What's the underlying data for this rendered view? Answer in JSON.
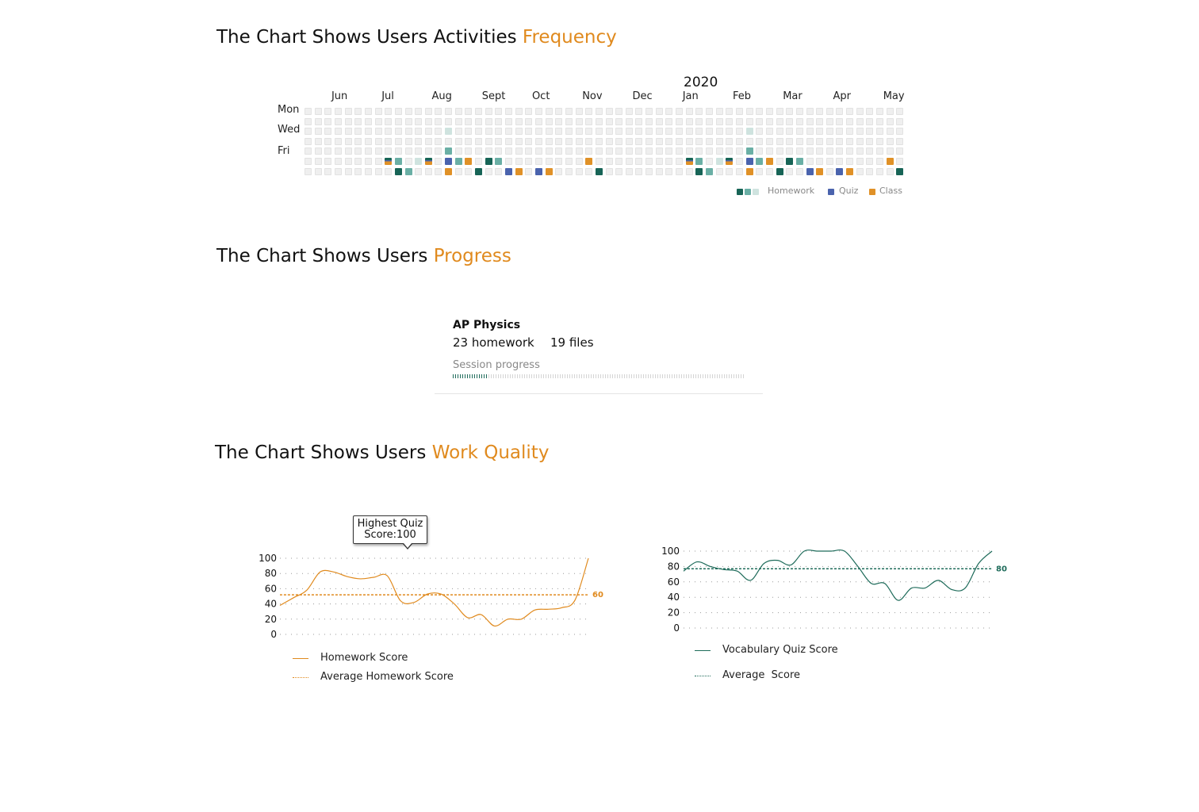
{
  "sections": {
    "frequency": {
      "title_prefix": "The Chart Shows Users Activities ",
      "title_accent": "Frequency"
    },
    "progress": {
      "title_prefix": "The Chart Shows Users ",
      "title_accent": "Progress"
    },
    "quality": {
      "title_prefix": "The Chart Shows Users ",
      "title_accent": "Work Quality"
    }
  },
  "heatmap": {
    "year": "2020",
    "months": [
      "Jun",
      "Jul",
      "Aug",
      "Sept",
      "Oct",
      "Nov",
      "Dec",
      "Jan",
      "Feb",
      "Mar",
      "Apr",
      "May"
    ],
    "month_start_weeks": [
      3,
      8,
      13,
      18,
      23,
      28,
      33,
      38,
      43,
      48,
      53,
      58
    ],
    "days": [
      "Mon",
      "Wed",
      "Fri"
    ],
    "weeks": 60,
    "colors": {
      "empty": "#efefef",
      "homework_dark": "#176456",
      "homework_mid": "#6aafa5",
      "homework_light": "#cfe3df",
      "quiz": "#4a63ad",
      "class": "#e09127"
    },
    "legend": {
      "homework": "Homework",
      "quiz": "Quiz",
      "class": "Class"
    },
    "activities": [
      {
        "w": 8,
        "d": 5,
        "t": "split"
      },
      {
        "w": 9,
        "d": 5,
        "t": "homework_mid"
      },
      {
        "w": 9,
        "d": 6,
        "t": "homework_dark"
      },
      {
        "w": 10,
        "d": 6,
        "t": "homework_mid"
      },
      {
        "w": 11,
        "d": 5,
        "t": "homework_light"
      },
      {
        "w": 12,
        "d": 5,
        "t": "split"
      },
      {
        "w": 14,
        "d": 2,
        "t": "homework_light"
      },
      {
        "w": 14,
        "d": 4,
        "t": "homework_mid"
      },
      {
        "w": 14,
        "d": 5,
        "t": "quiz"
      },
      {
        "w": 14,
        "d": 6,
        "t": "class"
      },
      {
        "w": 15,
        "d": 5,
        "t": "homework_mid"
      },
      {
        "w": 16,
        "d": 5,
        "t": "class"
      },
      {
        "w": 17,
        "d": 6,
        "t": "homework_dark"
      },
      {
        "w": 18,
        "d": 5,
        "t": "homework_dark"
      },
      {
        "w": 19,
        "d": 5,
        "t": "homework_mid"
      },
      {
        "w": 20,
        "d": 6,
        "t": "quiz"
      },
      {
        "w": 21,
        "d": 6,
        "t": "class"
      },
      {
        "w": 23,
        "d": 6,
        "t": "quiz"
      },
      {
        "w": 24,
        "d": 6,
        "t": "class"
      },
      {
        "w": 28,
        "d": 5,
        "t": "class"
      },
      {
        "w": 29,
        "d": 6,
        "t": "homework_dark"
      },
      {
        "w": 38,
        "d": 5,
        "t": "split"
      },
      {
        "w": 39,
        "d": 5,
        "t": "homework_mid"
      },
      {
        "w": 39,
        "d": 6,
        "t": "homework_dark"
      },
      {
        "w": 40,
        "d": 6,
        "t": "homework_mid"
      },
      {
        "w": 41,
        "d": 5,
        "t": "homework_light"
      },
      {
        "w": 42,
        "d": 5,
        "t": "split"
      },
      {
        "w": 44,
        "d": 2,
        "t": "homework_light"
      },
      {
        "w": 44,
        "d": 4,
        "t": "homework_mid"
      },
      {
        "w": 44,
        "d": 5,
        "t": "quiz"
      },
      {
        "w": 44,
        "d": 6,
        "t": "class"
      },
      {
        "w": 45,
        "d": 5,
        "t": "homework_mid"
      },
      {
        "w": 46,
        "d": 5,
        "t": "class"
      },
      {
        "w": 47,
        "d": 6,
        "t": "homework_dark"
      },
      {
        "w": 48,
        "d": 5,
        "t": "homework_dark"
      },
      {
        "w": 49,
        "d": 5,
        "t": "homework_mid"
      },
      {
        "w": 50,
        "d": 6,
        "t": "quiz"
      },
      {
        "w": 51,
        "d": 6,
        "t": "class"
      },
      {
        "w": 53,
        "d": 6,
        "t": "quiz"
      },
      {
        "w": 54,
        "d": 6,
        "t": "class"
      },
      {
        "w": 58,
        "d": 5,
        "t": "class"
      },
      {
        "w": 59,
        "d": 6,
        "t": "homework_dark"
      }
    ]
  },
  "progress_card": {
    "course": "AP Physics",
    "homework": "23 homework",
    "files": "19 files",
    "label": "Session progress",
    "progress": 0.12,
    "color": "#1e6b5a"
  },
  "chart_data": [
    {
      "type": "line",
      "title": "",
      "y_ticks": [
        0,
        20,
        40,
        60,
        80,
        100
      ],
      "ylim": [
        0,
        100
      ],
      "series": [
        {
          "name": "Homework Score",
          "style": "solid",
          "color": "#e08a1e",
          "values": [
            38,
            48,
            58,
            82,
            82,
            76,
            73,
            75,
            77,
            44,
            42,
            53,
            53,
            40,
            22,
            26,
            11,
            20,
            20,
            32,
            33,
            35,
            45,
            100
          ]
        },
        {
          "name": "Average Homework Score",
          "style": "dotted",
          "color": "#e08a1e",
          "values": [
            52,
            52
          ],
          "label": "60"
        }
      ],
      "tooltip": "Highest Quiz Score:100"
    },
    {
      "type": "line",
      "title": "",
      "y_ticks": [
        0,
        20,
        40,
        60,
        80,
        100
      ],
      "ylim": [
        0,
        100
      ],
      "series": [
        {
          "name": "Vocabulary Quiz Score",
          "style": "solid",
          "color": "#1e6b5a",
          "values": [
            74,
            86,
            80,
            76,
            74,
            62,
            84,
            88,
            82,
            100,
            100,
            100,
            100,
            80,
            58,
            58,
            36,
            52,
            52,
            62,
            50,
            52,
            84,
            100
          ]
        },
        {
          "name": "Average  Score",
          "style": "dotted",
          "color": "#1e6b5a",
          "values": [
            77,
            77
          ],
          "label": "80"
        }
      ]
    }
  ]
}
